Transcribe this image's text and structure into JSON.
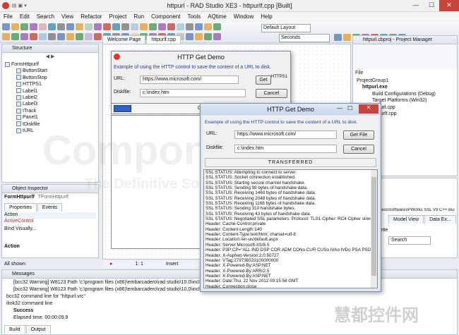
{
  "app": {
    "title": "httpurl - RAD Studio XE3 - httpurlf.cpp [Built]"
  },
  "window_controls": {
    "min": "—",
    "max": "☐",
    "close": "✕"
  },
  "menu": [
    "File",
    "Edit",
    "Search",
    "View",
    "Refactor",
    "Project",
    "Run",
    "Component",
    "Tools",
    "AQtime",
    "Window",
    "Help"
  ],
  "toolbar": {
    "layout": "Default Layout",
    "units": "Seconds"
  },
  "structure": {
    "title": "Structure",
    "root": "FormHttpurlf",
    "items": [
      "ButtonStart",
      "ButtonStop",
      "HTTPS1",
      "Label1",
      "Label2",
      "Label3",
      "ITrack",
      "Panel1",
      "tDiskfile",
      "tURL"
    ]
  },
  "inspector": {
    "title": "Object Inspector",
    "object": "FormHttpurlf",
    "object_type": "TFormHttpurlf",
    "tabs": [
      "Properties",
      "Events"
    ],
    "row1": "Action",
    "row2": "ActiveControl",
    "bind": "Bind Visually...",
    "footer": "Action",
    "all_shown": "All shown"
  },
  "editor": {
    "tabs": [
      "Welcome Page",
      "httpurlf.cpp"
    ],
    "status_pos": "1: 1",
    "status_mode": "Insert"
  },
  "designer": {
    "title": "HTTP Get Demo",
    "desc": "Example of using the HTTP control to save the content of a URL to disk.",
    "url_label": "URL:",
    "url_value": "https://www.microsoft.com/",
    "disk_label": "Diskfile:",
    "disk_value": "c:\\index.htm",
    "https_label": "HTTPS1",
    "get_button": "Get",
    "cancel_button": "Cancel",
    "counter": "0"
  },
  "demo": {
    "title": "HTTP Get Demo",
    "desc": "Example of using the HTTP control to save the content of a URL to disk.",
    "url_label": "URL:",
    "url_value": "https://www.microsoft.com/",
    "disk_label": "Diskfile:",
    "disk_value": "c:\\index.htm",
    "get_button": "Get File",
    "cancel_button": "Cancel",
    "status": "TRANSFERRED",
    "log": [
      "SSL STATUS: Attempting to connect to server.",
      "SSL STATUS: Socket connection established.",
      "SSL STATUS: Starting secure channel handshake.",
      "SSL STATUS: Sending 99 bytes of handshake data.",
      "SSL STATUS: Receiving 1460 bytes of handshake data.",
      "SSL STATUS: Receiving 2048 bytes of handshake data.",
      "SSL STATUS: Receiving 1168 bytes of handshake data.",
      "SSL STATUS: Sending 310 handshake bytes.",
      "SSL STATUS: Receiving 43 bytes of handshake data.",
      "SSL STATUS: Negotiated SSL parameters: Protocol: TLS1 Cipher: RC4 Cipher strengt",
      "Header: Cache-Control:private",
      "Header: Content-Length:140",
      "Header: Content-Type:text/html; charset=utf-8",
      "Header: Location:/en-us/default.aspx",
      "Header: Server:Microsoft-IIS/8.0",
      "Header: P3P:CP=\"ALL IND DSP COR ADM CONo CUR CUSo IVAo IVDo PSA PSD T",
      "Header: X-AspNet-Version:2.0.50727",
      "Header: VTag:279736533100000000",
      "Header: X-Powered-By:ASP.NET",
      "Header: X-Powered-By:ARR/2.5",
      "Header: X-Powered-By:ASP.NET",
      "Header: Date:Thu, 22 Nov 2012 09:15:58 GMT",
      "Header: Connection:close"
    ]
  },
  "project": {
    "title": "httpurl.cbproj - Project Manager",
    "col": "File",
    "items": [
      "ProjectGroup1",
      "httpurl.exe",
      "Build Configurations (Debug)",
      "Target Platforms (Win32)",
      "httpurl.cpp",
      "httpurlf.cpp"
    ]
  },
  "right_lower": {
    "path": "files\\nsoftware\\IPWorks SSL V9 C++ Bui",
    "model_view": "Model View",
    "data_ex": "Data Ex...",
    "palette": "lette",
    "search": "Search"
  },
  "messages": {
    "title": "Messages",
    "lines": [
      "[bcc32 Warning] W8123 Path 'c:\\program files (x86)\\embarcadero\\rad studio\\10.0\\include\\vcl' no",
      "[bcc32 Warning] W8123 Path 'c:\\program files (x86)\\embarcadero\\rad studio\\10.0\\include\\vcl' no",
      "bcc32 command line for \"httpurl.vrc\"",
      "ilink32 command line",
      "Success",
      "Elapsed time: 00:00:09.9"
    ],
    "tabs": [
      "Build",
      "Output"
    ]
  },
  "watermark": {
    "big": "Component Source",
    "sub": "The Definitive Source of Software Components",
    "brand": "慧都控件网"
  },
  "colors": {
    "accent": "#2a62c9",
    "window_border": "#7a8fb0",
    "log_bg": "#ffffff"
  }
}
